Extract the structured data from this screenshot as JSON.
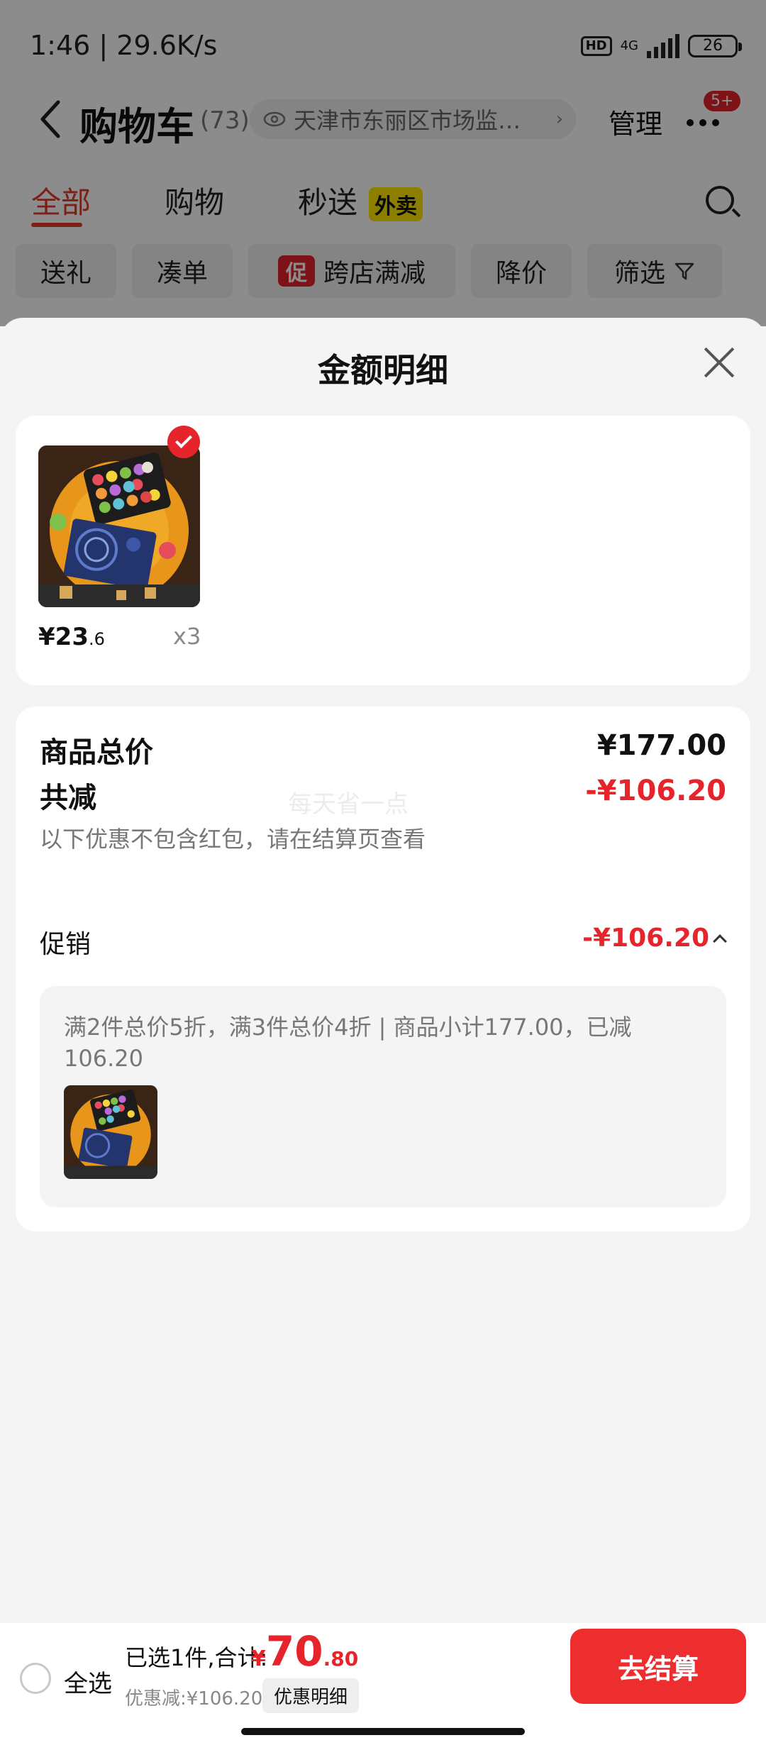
{
  "status_bar": {
    "time": "1:46 | 29.6K/s",
    "hd": "HD",
    "network": "4G",
    "battery": "26"
  },
  "header": {
    "title": "购物车",
    "count": "(73)",
    "address": "天津市东丽区市场监…",
    "manage": "管理",
    "notification": "5+"
  },
  "tabs": [
    {
      "label": "全部"
    },
    {
      "label": "购物"
    },
    {
      "label": "秒送"
    }
  ],
  "tab_tag": "外卖",
  "chips": [
    {
      "label": "送礼"
    },
    {
      "label": "凑单"
    },
    {
      "label": "跨店满减",
      "badge": "促"
    },
    {
      "label": "降价"
    },
    {
      "label": "筛选"
    }
  ],
  "sheet": {
    "title": "金额明细",
    "product": {
      "price_int": "¥23",
      "price_dec": ".6",
      "quantity": "x3"
    },
    "total_label": "商品总价",
    "total_value": "¥177.00",
    "reduce_label": "共减",
    "reduce_value": "-¥106.20",
    "note": "以下优惠不包含红包，请在结算页查看",
    "watermark": "每天省一点",
    "promo_label": "促销",
    "promo_value": "-¥106.20",
    "promo_desc": "满2件总价5折，满3件总价4折 | 商品小计177.00，已减106.20"
  },
  "bottom_bar": {
    "select_all": "全选",
    "summary": "已选1件,合计:",
    "yen": "¥",
    "total_int": "70",
    "total_dec": ".80",
    "discount": "优惠减:¥106.20",
    "detail_button": "优惠明细",
    "checkout": "去结算"
  },
  "colors": {
    "accent": "#e5242b",
    "checkout": "#ee2d2f",
    "background": "#f4f4f4"
  }
}
